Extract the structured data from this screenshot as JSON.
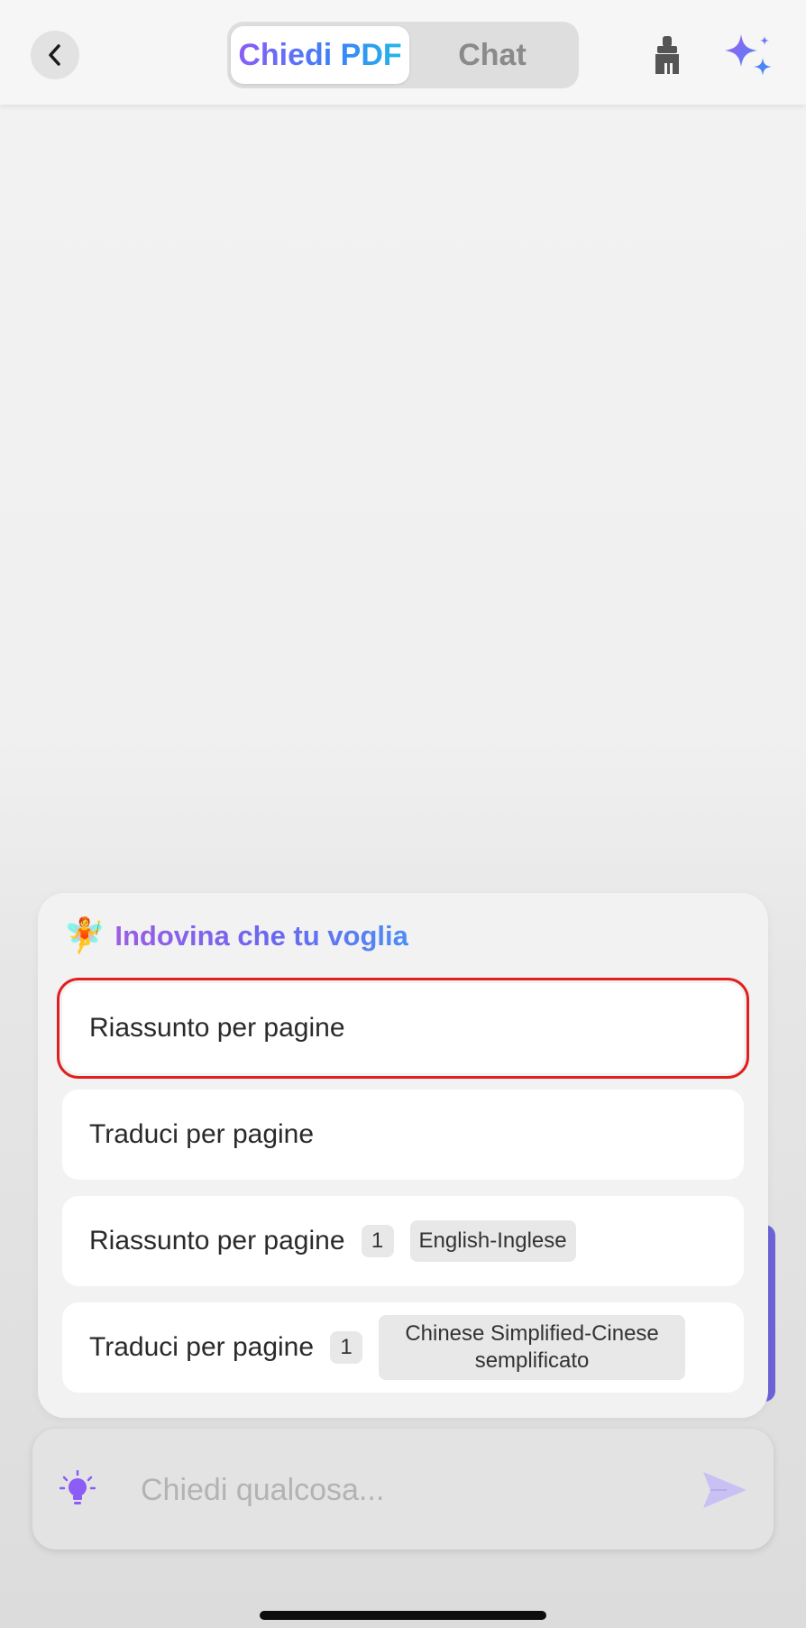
{
  "header": {
    "segments": [
      {
        "label": "Chiedi PDF",
        "active": true
      },
      {
        "label": "Chat",
        "active": false
      }
    ],
    "icons": {
      "back": "chevron-left-icon",
      "clean": "broom-icon",
      "ai": "sparkle-icon"
    }
  },
  "suggestions": {
    "title": "Indovina che tu voglia",
    "emoji": "🧚",
    "items": [
      {
        "label": "Riassunto per pagine",
        "selected": true
      },
      {
        "label": "Traduci per pagine",
        "selected": false
      },
      {
        "label": "Riassunto per pagine",
        "page": "1",
        "language": "English-Inglese"
      },
      {
        "label": "Traduci per pagine",
        "page": "1",
        "language": "Chinese Simplified-Cinese semplificato"
      }
    ]
  },
  "input": {
    "placeholder": "Chiedi qualcosa...",
    "value": ""
  },
  "colors": {
    "accent_purple": "#8b5cf6",
    "accent_blue": "#3b82f6",
    "highlight_red": "#e02020"
  }
}
